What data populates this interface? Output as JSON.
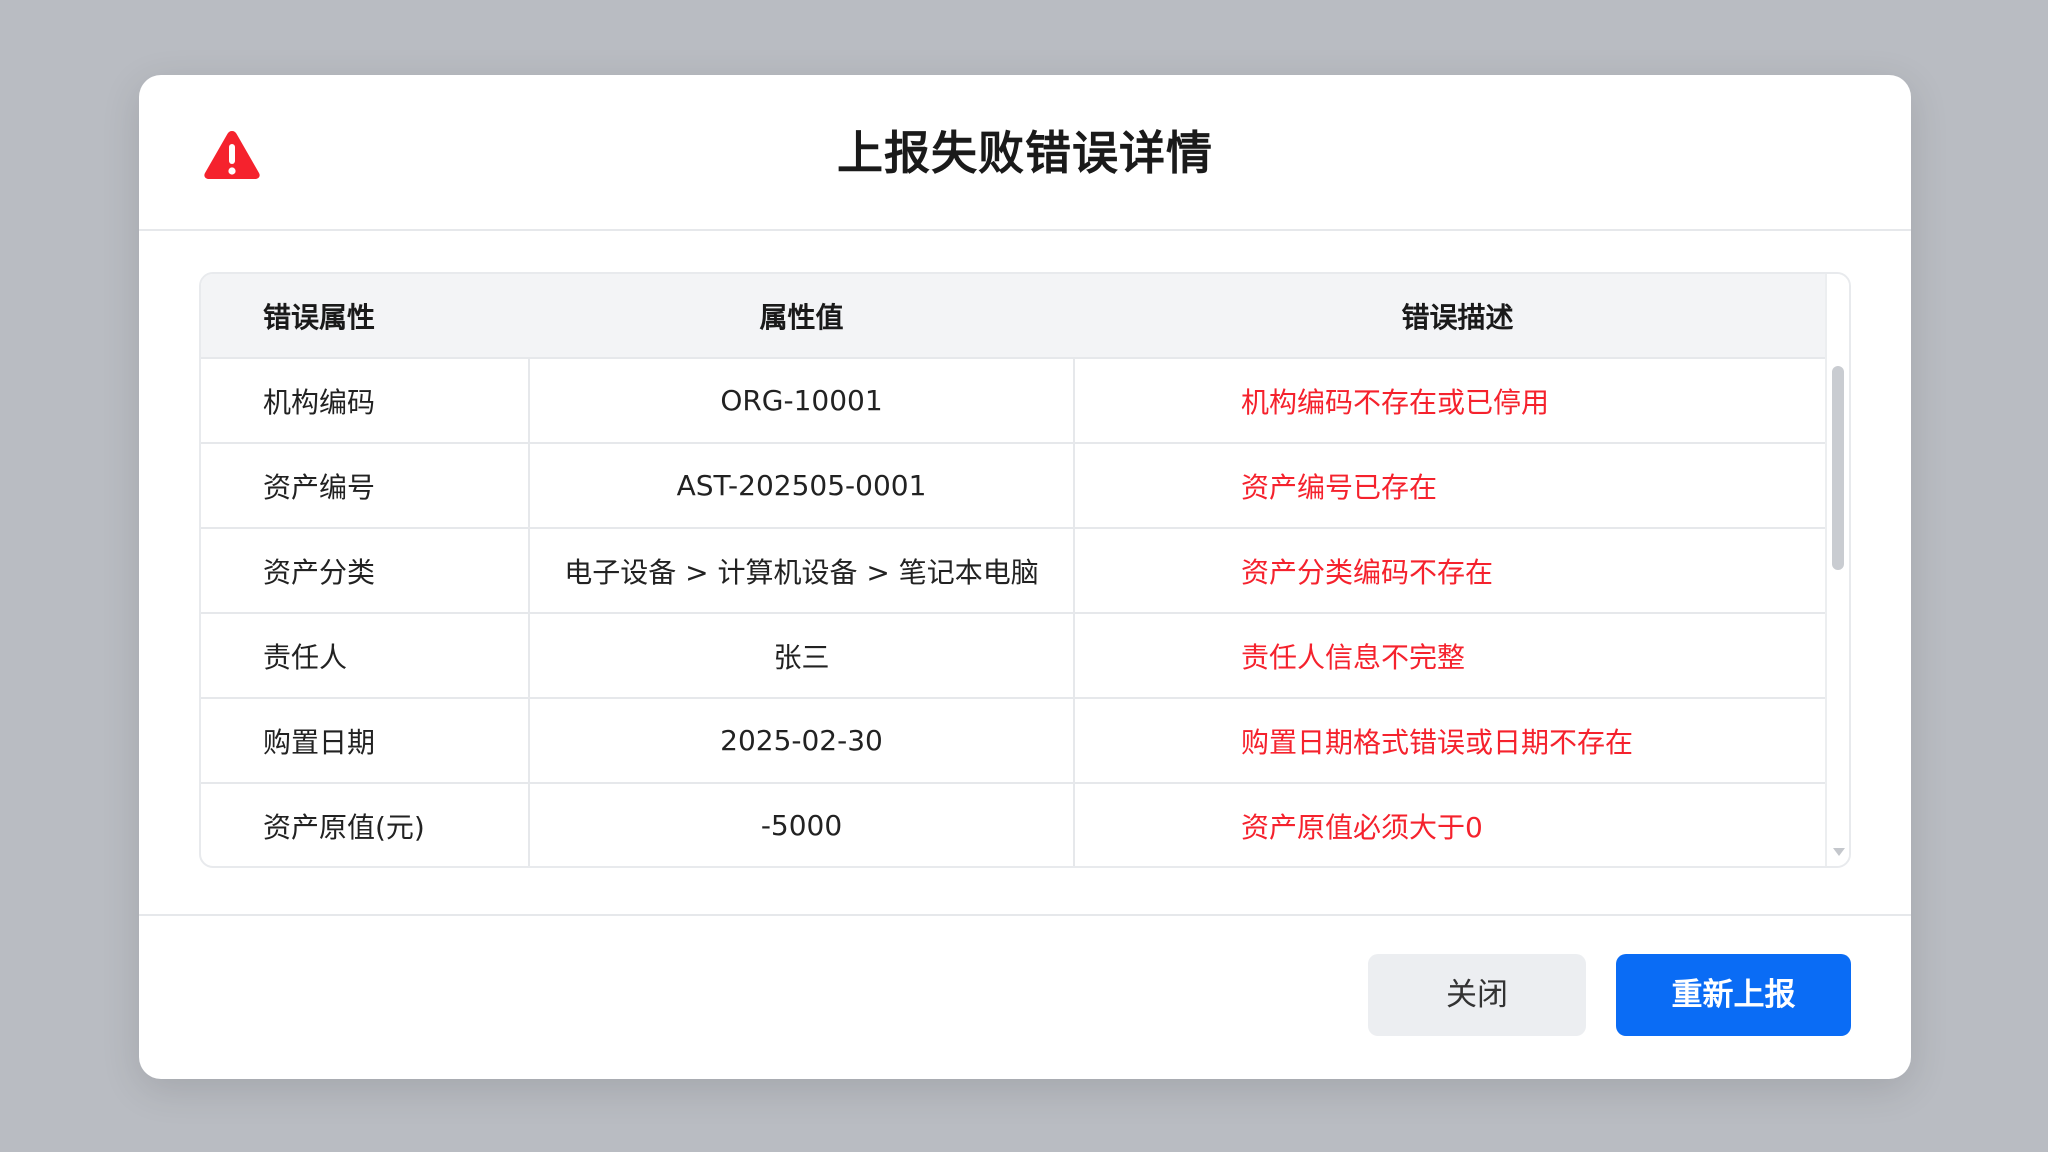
{
  "dialog": {
    "title": "上报失败错误详情",
    "icon": "warning-triangle-icon",
    "accent_color": "#0a6cf5",
    "error_color": "#f5222d"
  },
  "table": {
    "headers": [
      "错误属性",
      "属性值",
      "错误描述"
    ],
    "rows": [
      {
        "attribute": "机构编码",
        "value": "ORG-10001",
        "description": "机构编码不存在或已停用"
      },
      {
        "attribute": "资产编号",
        "value": "AST-202505-0001",
        "description": "资产编号已存在"
      },
      {
        "attribute": "资产分类",
        "value": "电子设备 > 计算机设备 > 笔记本电脑",
        "description": "资产分类编码不存在"
      },
      {
        "attribute": "责任人",
        "value": "张三",
        "description": "责任人信息不完整"
      },
      {
        "attribute": "购置日期",
        "value": "2025-02-30",
        "description": "购置日期格式错误或日期不存在"
      },
      {
        "attribute": "资产原值(元)",
        "value": "-5000",
        "description": "资产原值必须大于0"
      }
    ]
  },
  "footer": {
    "close_label": "关闭",
    "retry_label": "重新上报"
  }
}
